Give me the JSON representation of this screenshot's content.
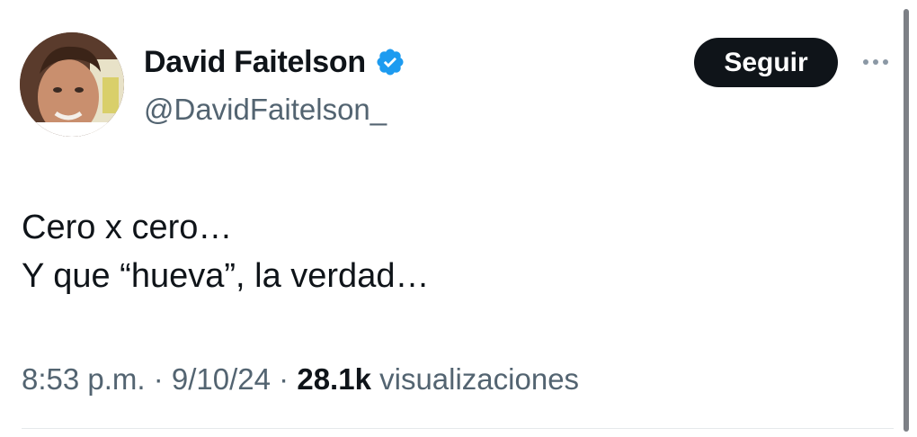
{
  "author": {
    "display_name": "David Faitelson",
    "handle": "@DavidFaitelson_",
    "verified_icon": "verified-badge-icon",
    "avatar": "profile-photo"
  },
  "actions": {
    "follow_label": "Seguir",
    "more_icon": "more-options-icon"
  },
  "tweet": {
    "lines": [
      "Cero x cero…",
      "Y que “hueva”, la verdad…"
    ]
  },
  "meta": {
    "time": "8:53 p.m.",
    "sep1": " · ",
    "date": "9/10/24",
    "sep2": " · ",
    "views_count": "28.1k",
    "views_label": " visualizaciones"
  },
  "colors": {
    "verified": "#1d9bf0",
    "button_bg": "#0f1419",
    "secondary_text": "#536471"
  }
}
